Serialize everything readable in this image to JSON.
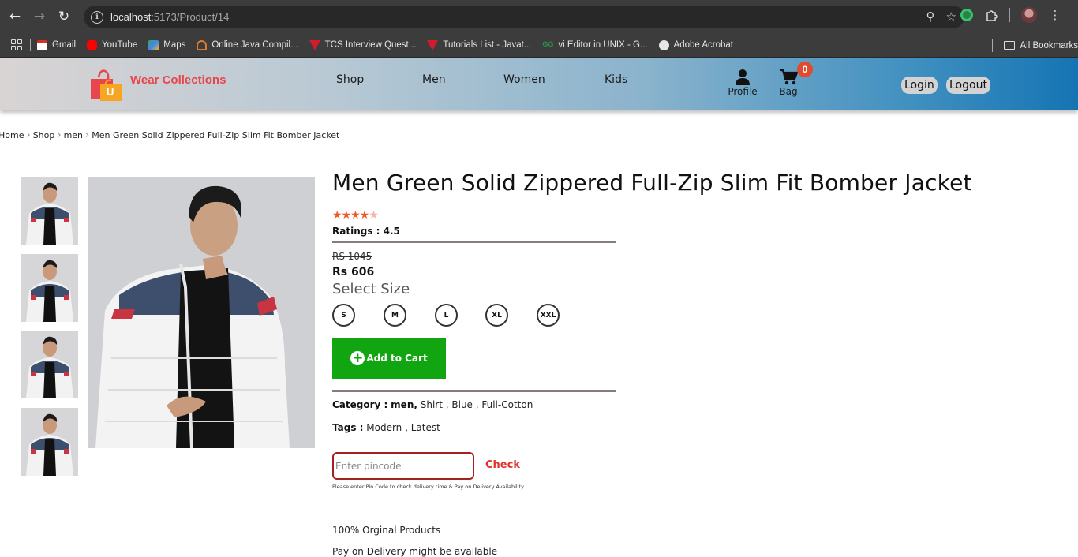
{
  "browser": {
    "url_host": "localhost",
    "url_path": ":5173/Product/14"
  },
  "bookmarks": [
    {
      "label": "Gmail",
      "color": "#d93025"
    },
    {
      "label": "YouTube",
      "color": "#ff0000"
    },
    {
      "label": "Maps",
      "color": "#34a853"
    },
    {
      "label": "Online Java Compil...",
      "color": "#e07a2f"
    },
    {
      "label": "TCS Interview Quest...",
      "color": "#d21c2b"
    },
    {
      "label": "Tutorials List - Javat...",
      "color": "#d21c2b"
    },
    {
      "label": "vi Editor in UNIX - G...",
      "color": "#2f8d46"
    },
    {
      "label": "Adobe Acrobat",
      "color": "#e6e6e6"
    }
  ],
  "bookmarks_right": "All Bookmarks",
  "site": {
    "brand": "Wear Collections",
    "logo_letter": "U",
    "nav": [
      "Shop",
      "Men",
      "Women",
      "Kids"
    ],
    "profile_label": "Profile",
    "bag_label": "Bag",
    "bag_count": "0",
    "login": "Login",
    "logout": "Logout"
  },
  "breadcrumb": [
    "Home",
    "Shop",
    "men",
    "Men Green Solid Zippered Full-Zip Slim Fit Bomber Jacket"
  ],
  "product": {
    "title": "Men Green Solid Zippered Full-Zip Slim Fit Bomber Jacket",
    "rating_stars": 4,
    "stars_full": "★★★★",
    "stars_empty": "★",
    "ratings_label": "Ratings : 4.5",
    "old_price": "RS 1045",
    "new_price": "Rs 606",
    "select_size": "Select Size",
    "sizes": [
      "S",
      "M",
      "L",
      "XL",
      "XXL"
    ],
    "add_to_cart": "Add to Cart",
    "category_label": "Category :",
    "category_main": "men,",
    "category_rest": " Shirt , Blue , Full-Cotton",
    "tags_label": "Tags :",
    "tags": " Modern , Latest",
    "pincode_placeholder": "Enter pincode",
    "check": "Check",
    "pin_note": "Please enter Pin Code to check delivery time & Pay on Delivery Availability",
    "features": [
      "100% Orginal Products",
      "Pay on Delivery might be available"
    ]
  },
  "colors": {
    "brand_red": "#e8454d",
    "cart_green": "#10a511",
    "check_red": "#e0352f",
    "star": "#f05a28"
  }
}
